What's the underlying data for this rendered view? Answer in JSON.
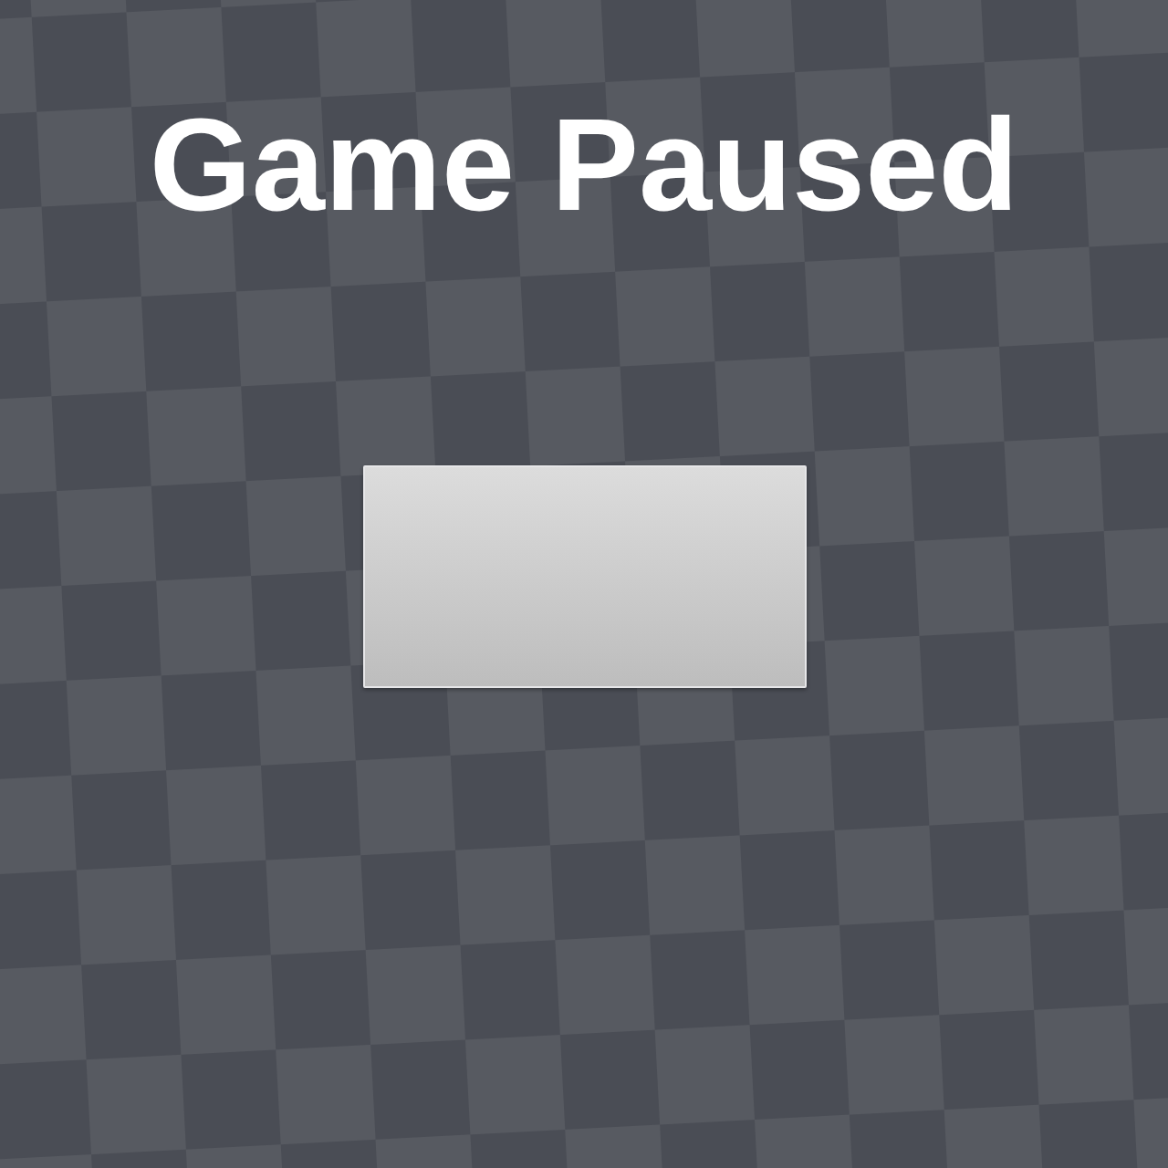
{
  "title": "Game Paused"
}
